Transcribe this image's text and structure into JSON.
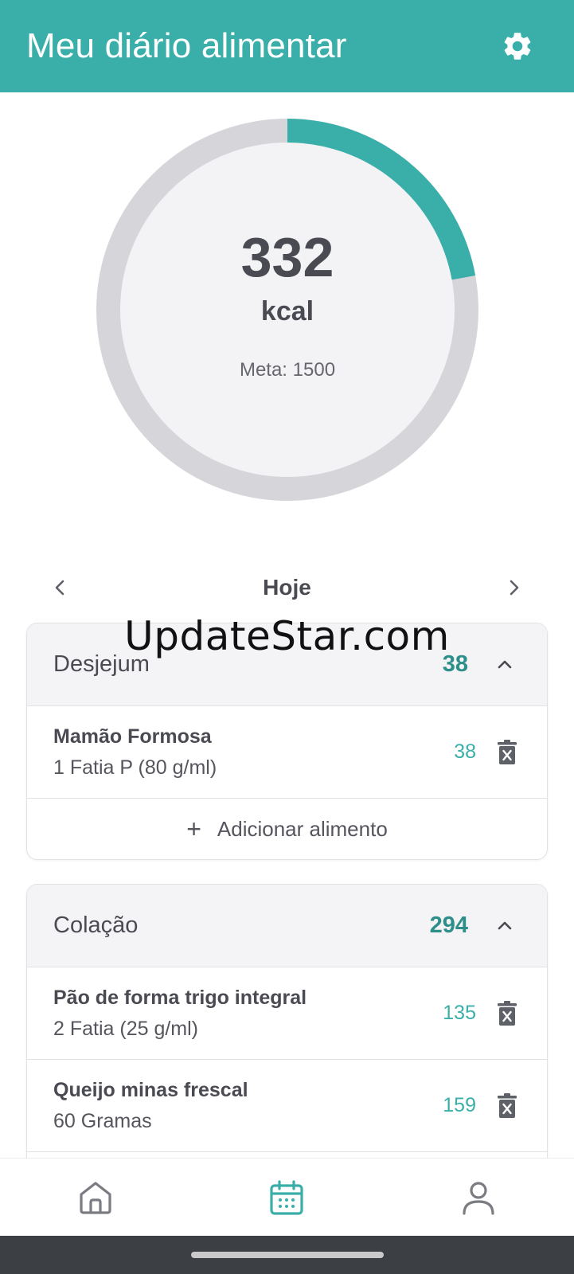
{
  "appbar": {
    "title": "Meu diário alimentar",
    "settings_icon": "gear-icon"
  },
  "summary": {
    "kcal_value": "332",
    "kcal_unit": "kcal",
    "goal_label": "Meta: 1500",
    "progress_fraction": 0.2213,
    "colors": {
      "progress": "#3aafa9",
      "track": "#d6d6da",
      "fill": "#f3f3f5"
    }
  },
  "date_nav": {
    "label": "Hoje",
    "prev_icon": "chevron-left-icon",
    "next_icon": "chevron-right-icon"
  },
  "watermark": "UpdateStar.com",
  "meals": [
    {
      "name": "Desjejum",
      "total": "38",
      "items": [
        {
          "name": "Mamão Formosa",
          "portion": "1 Fatia P (80 g/ml)",
          "kcal": "38"
        }
      ],
      "add_label": "Adicionar alimento"
    },
    {
      "name": "Colação",
      "total": "294",
      "items": [
        {
          "name": "Pão de forma trigo integral",
          "portion": "2 Fatia (25 g/ml)",
          "kcal": "135"
        },
        {
          "name": "Queijo minas frescal",
          "portion": "60 Gramas",
          "kcal": "159"
        }
      ]
    }
  ],
  "bottom_nav": [
    {
      "icon": "home-icon",
      "active": false
    },
    {
      "icon": "calendar-icon",
      "active": true
    },
    {
      "icon": "user-icon",
      "active": false
    }
  ],
  "theme": {
    "accent": "#3aafa9",
    "accent_dark": "#2e8f8a",
    "icon_gray": "#5f6168"
  }
}
